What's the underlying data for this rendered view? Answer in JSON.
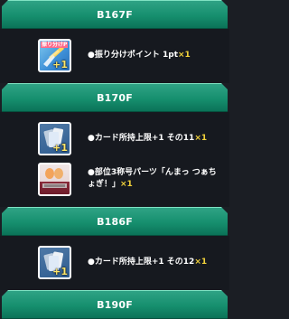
{
  "sections": [
    {
      "floor": "B167F",
      "rewards": [
        {
          "icon": "points-card-icon",
          "icon_caption": "振り分けP",
          "plus": "+1",
          "text": "●振り分けポイント 1pt",
          "qty": "×1"
        }
      ]
    },
    {
      "floor": "B170F",
      "rewards": [
        {
          "icon": "card-limit-icon",
          "plus": "+1",
          "text": "●カード所持上限+1 その11",
          "qty": "×1"
        },
        {
          "icon": "title-parts-icon",
          "plus": "",
          "text": "●部位3称号パーツ「んまっ つぁちょぎ！」",
          "qty": "×1"
        }
      ]
    },
    {
      "floor": "B186F",
      "rewards": [
        {
          "icon": "card-limit-icon",
          "plus": "+1",
          "text": "●カード所持上限+1 その12",
          "qty": "×1"
        }
      ]
    },
    {
      "floor": "B190F",
      "rewards": []
    }
  ]
}
